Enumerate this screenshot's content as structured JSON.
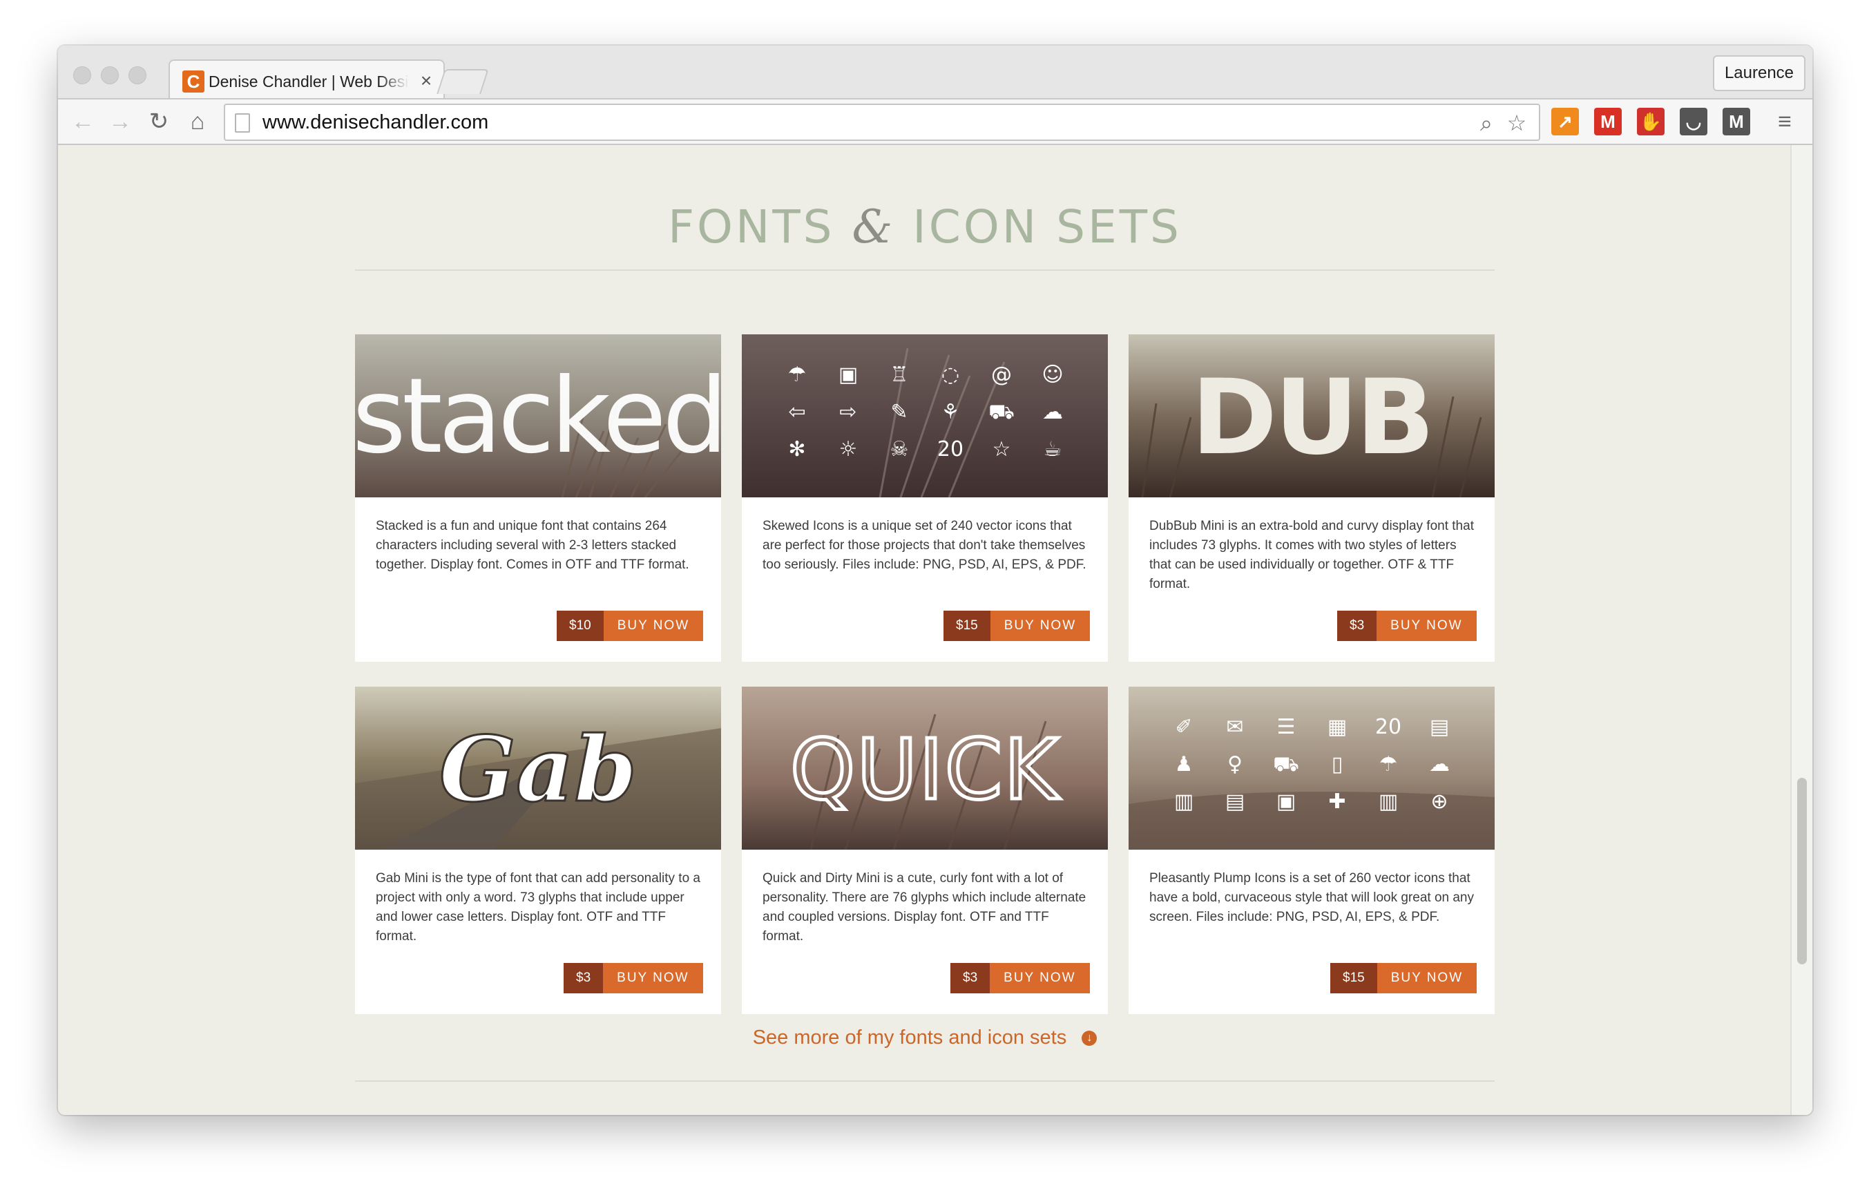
{
  "browser": {
    "tab_title": "Denise Chandler | Web Designer",
    "tab_favicon_letter": "C",
    "tab_close": "×",
    "profile_name": "Laurence",
    "url": "www.denisechandler.com",
    "back_glyph": "←",
    "forward_glyph": "→",
    "reload_glyph": "↻",
    "home_glyph": "⌂",
    "search_glyph": "⌕",
    "star_glyph": "☆",
    "menu_glyph": "≡"
  },
  "extensions": [
    {
      "name": "analytics-extension-icon",
      "glyph": "↗",
      "color": "#f08a1c"
    },
    {
      "name": "gmail-extension-icon",
      "glyph": "M",
      "color": "#d93025"
    },
    {
      "name": "adblock-extension-icon",
      "glyph": "✋",
      "color": "#d0312d"
    },
    {
      "name": "pocket-extension-icon",
      "glyph": "◡",
      "color": "#555555"
    },
    {
      "name": "m-extension-icon",
      "glyph": "M",
      "color": "#555555"
    }
  ],
  "section": {
    "title_part1": "FONTS",
    "title_amp": "&",
    "title_part2": "ICON SETS"
  },
  "products": [
    {
      "image_text": "stacked",
      "description": "Stacked is a fun and unique font that contains 264 characters including several with 2-3 letters stacked together. Display font. Comes in OTF and TTF format.",
      "price": "$10",
      "buy_label": "BUY NOW"
    },
    {
      "image_text": "",
      "image_icons": [
        "☂",
        "▣",
        "♖",
        "◌",
        "@",
        "☺",
        "⇦",
        "⇨",
        "✎",
        "⚘",
        "⛟",
        "☁",
        "✻",
        "☼",
        "☠",
        "20",
        "☆",
        "☕"
      ],
      "description": "Skewed Icons is a unique set of 240 vector icons that are perfect for those projects that don't take themselves too seriously. Files include: PNG, PSD, AI, EPS, & PDF.",
      "price": "$15",
      "buy_label": "BUY NOW"
    },
    {
      "image_text": "DUB",
      "description": "DubBub Mini is an extra-bold and curvy display font that includes 73 glyphs. It comes with two styles of letters that can be used individually or together. OTF & TTF format.",
      "price": "$3",
      "buy_label": "BUY NOW"
    },
    {
      "image_text": "Gab",
      "description": "Gab Mini is the type of font that can add personality to a project with only a word. 73 glyphs that include upper and lower case letters. Display font. OTF and TTF format.",
      "price": "$3",
      "buy_label": "BUY NOW"
    },
    {
      "image_text": "QUICK",
      "description": "Quick and Dirty Mini is a cute, curly font with a lot of personality. There are 76 glyphs which include alternate and coupled versions. Display font. OTF and TTF format.",
      "price": "$3",
      "buy_label": "BUY NOW"
    },
    {
      "image_text": "",
      "image_icons": [
        "✐",
        "✉",
        "☰",
        "▦",
        "20",
        "▤",
        "♟",
        "♀",
        "⛟",
        "▯",
        "☂",
        "☁",
        "▥",
        "▤",
        "▣",
        "✚",
        "▥",
        "⊕"
      ],
      "description": "Pleasantly Plump Icons is a set of 260 vector icons that have a bold, curvaceous style that will look great on any screen. Files include: PNG, PSD, AI, EPS, & PDF.",
      "price": "$15",
      "buy_label": "BUY NOW"
    }
  ],
  "more_link": {
    "label": "See more of my fonts and icon sets",
    "icon_glyph": "↓"
  }
}
